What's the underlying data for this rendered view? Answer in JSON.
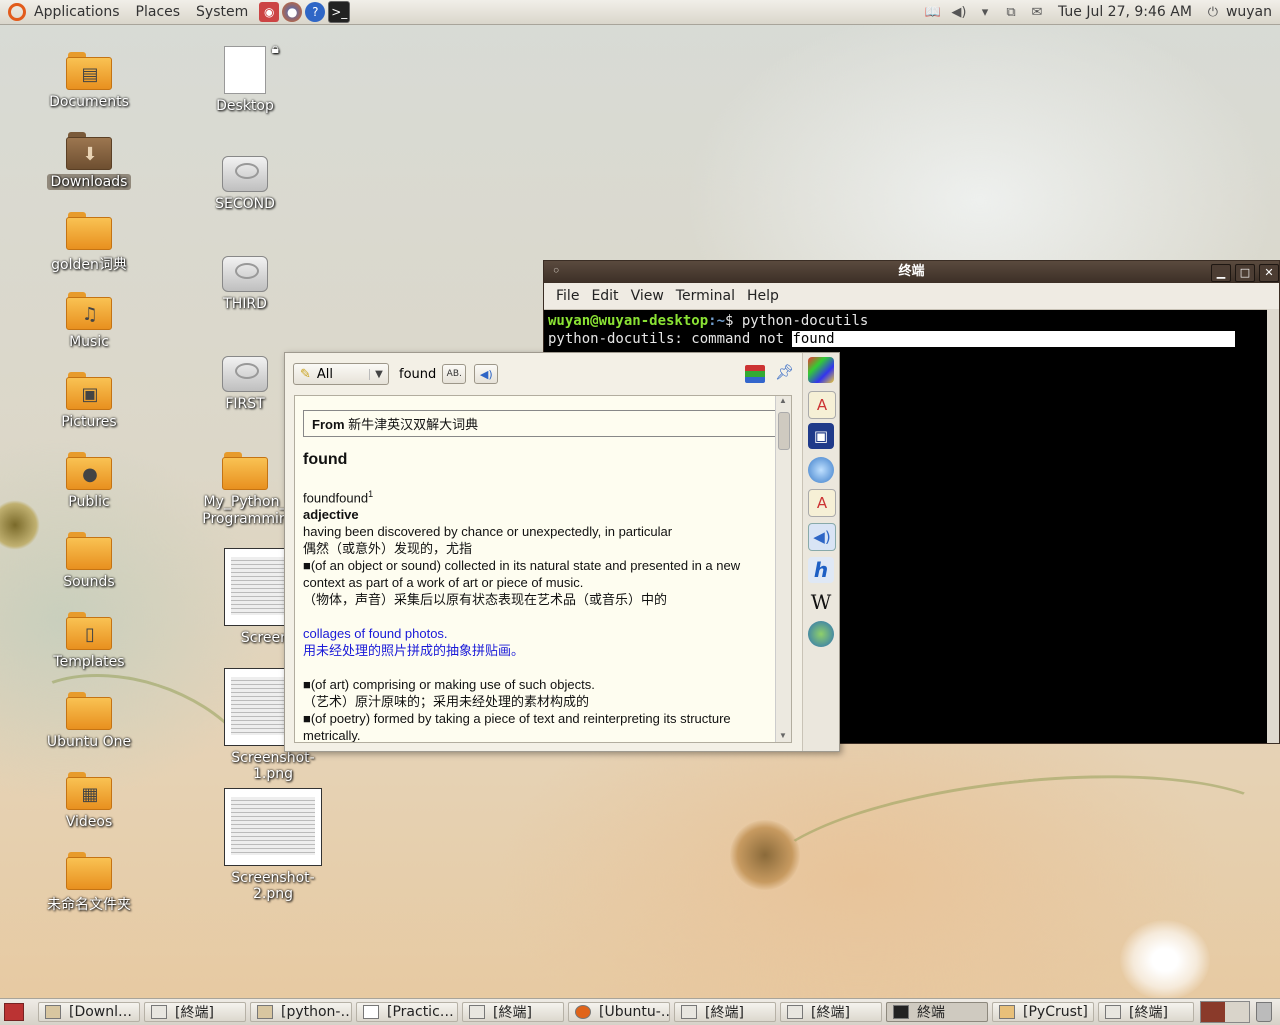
{
  "top_panel": {
    "menus": [
      "Applications",
      "Places",
      "System"
    ],
    "clock": "Tue Jul 27,  9:46 AM",
    "user": "wuyan"
  },
  "desktop_icons": {
    "col1": [
      "Documents",
      "Downloads",
      "golden词典",
      "Music",
      "Pictures",
      "Public",
      "Sounds",
      "Templates",
      "Ubuntu One",
      "Videos",
      "未命名文件夹"
    ],
    "desktop": "Desktop",
    "second": "SECOND",
    "third": "THIRD",
    "first": "FIRST",
    "my_python": "My_Python_\nProgrammin",
    "screenshot": "Screensh",
    "screenshot1": "Screenshot-1.png",
    "screenshot2": "Screenshot-2.png"
  },
  "terminal": {
    "title": "终端",
    "menus": [
      "File",
      "Edit",
      "View",
      "Terminal",
      "Help"
    ],
    "prompt_user": "wuyan@wuyan-desktop",
    "prompt_path": ":~",
    "prompt_sym": "$",
    "command": " python-docutils",
    "output_line": "python-docutils: command not ",
    "selected_word": "found"
  },
  "dictionary": {
    "group_select": "All",
    "query": "found",
    "ab_button": "AB.",
    "from_label": "From",
    "dict_name": "新牛津英汉双解大词典",
    "headword": "found",
    "forms": "foundfound",
    "sup": "1",
    "pos": "adjective",
    "lines": [
      "having been discovered by chance or unexpectedly, in particular",
      "偶然（或意外）发现的，尤指",
      "■(of an object or sound) collected in its natural state and presented in a new context as part of a work of art or piece of music.",
      "（物体，声音）采集后以原有状态表现在艺术品（或音乐）中的"
    ],
    "example_en": "collages of found photos.",
    "example_zh": "用未经处理的照片拼成的抽象拼贴画。",
    "lines2": [
      "■(of art) comprising or making use of such objects.",
      "（艺术）原汁原味的；采用未经处理的素材构成的",
      "■(of poetry) formed by taking a piece of text and reinterpreting its structure metrically."
    ],
    "side_icons": [
      "color-icon",
      "text-icon",
      "select-icon",
      "globe-ball-icon",
      "text2-icon",
      "speaker-icon",
      "h-icon",
      "wikipedia-icon",
      "earth-icon"
    ],
    "wiki_letter": "W",
    "h_letter": "h"
  },
  "taskbar": {
    "tasks": [
      "[Downl…",
      "[終端]",
      "[python-…",
      "[Practic…",
      "[終端]",
      "[Ubuntu-…",
      "[終端]",
      "[終端]",
      "終端",
      "[PyCrust]",
      "[終端]"
    ],
    "active_index": 8
  }
}
